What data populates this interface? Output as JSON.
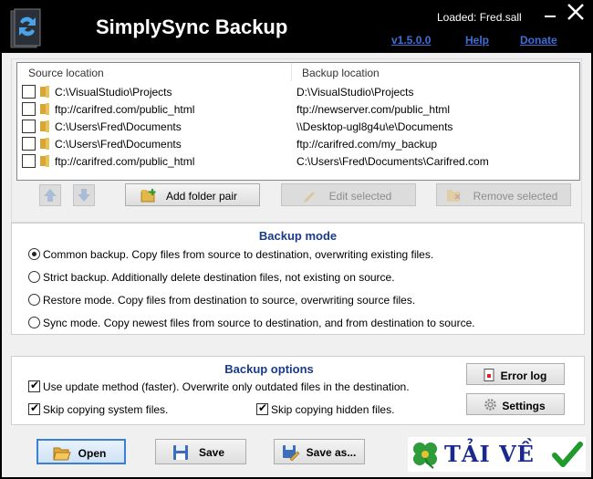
{
  "window": {
    "title": "SimplySync Backup",
    "loaded": "Loaded: Fred.sall",
    "version_link": "v1.5.0.0",
    "help_link": "Help",
    "donate_link": "Donate"
  },
  "folders": {
    "headers": {
      "source": "Source location",
      "backup": "Backup location"
    },
    "rows": [
      {
        "source": "C:\\VisualStudio\\Projects",
        "backup": "D:\\VisualStudio\\Projects"
      },
      {
        "source": "ftp://carifred.com/public_html",
        "backup": "ftp://newserver.com/public_html"
      },
      {
        "source": "C:\\Users\\Fred\\Documents",
        "backup": "\\\\Desktop-ugl8g4u\\e\\Documents"
      },
      {
        "source": "C:\\Users\\Fred\\Documents",
        "backup": "ftp://carifred.com/my_backup"
      },
      {
        "source": "ftp://carifred.com/public_html",
        "backup": "C:\\Users\\Fred\\Documents\\Carifred.com"
      }
    ],
    "add_label": "Add folder pair",
    "edit_label": "Edit selected",
    "remove_label": "Remove selected"
  },
  "backup_mode": {
    "title": "Backup mode",
    "selected": 0,
    "options": [
      "Common backup. Copy files from source to destination, overwriting existing files.",
      "Strict backup. Additionally delete destination files, not existing on source.",
      "Restore mode. Copy files from destination to source, overwriting source files.",
      "Sync mode. Copy newest files from source to destination, and from destination to source."
    ]
  },
  "backup_options": {
    "title": "Backup options",
    "update_method": "Use update method (faster). Overwrite only outdated files in the destination.",
    "skip_system": "Skip copying system files.",
    "skip_hidden": "Skip copying hidden files.",
    "error_log_label": "Error log",
    "settings_label": "Settings"
  },
  "footer": {
    "open_label": "Open",
    "save_label": "Save",
    "save_as_label": "Save as...",
    "watermark": "TẢI VỀ"
  },
  "colors": {
    "link": "#3d6fd6",
    "section_title": "#1a3a8a",
    "watermark_text": "#1a2a8c",
    "check_green": "#1f9a2b"
  }
}
